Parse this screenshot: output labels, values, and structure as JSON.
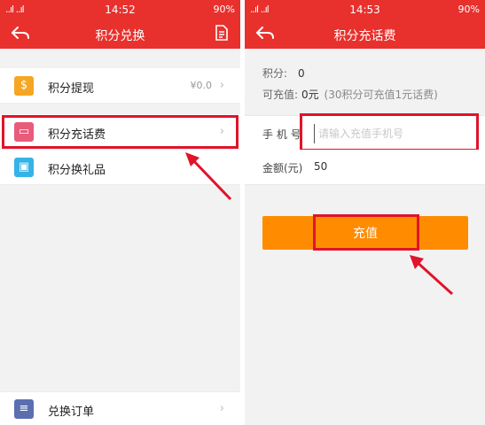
{
  "left": {
    "status": {
      "signal": "..ıl ..ıl",
      "time": "14:52",
      "battery": "90%"
    },
    "title": "积分兑换",
    "menu": [
      {
        "label": "积分提现",
        "value": "¥0.0",
        "icon": "dollar-icon",
        "color": "#f5a623",
        "glyph": "$"
      },
      {
        "label": "积分充话费",
        "value": "",
        "icon": "phone-card-icon",
        "color": "#e85b7a",
        "glyph": "▭"
      },
      {
        "label": "积分换礼品",
        "value": "",
        "icon": "gift-icon",
        "color": "#35b3e6",
        "glyph": "▣"
      }
    ],
    "bottom": {
      "label": "兑换订单",
      "icon": "order-list-icon",
      "color": "#5b6fb0"
    }
  },
  "right": {
    "status": {
      "signal": "..ıl ..ıl",
      "time": "14:53",
      "battery": "90%"
    },
    "title": "积分充话费",
    "points_label": "积分:",
    "points_value": "0",
    "available_label": "可充值:",
    "available_value": "0元",
    "available_note": "(30积分可充值1元话费)",
    "phone_label": "手 机 号",
    "phone_placeholder": "请输入充值手机号",
    "amount_label": "金额(元)",
    "amount_value": "50",
    "button_label": "充值"
  },
  "colors": {
    "brand": "#e8312d",
    "button": "#ff8c00",
    "highlight": "#e0142a"
  }
}
